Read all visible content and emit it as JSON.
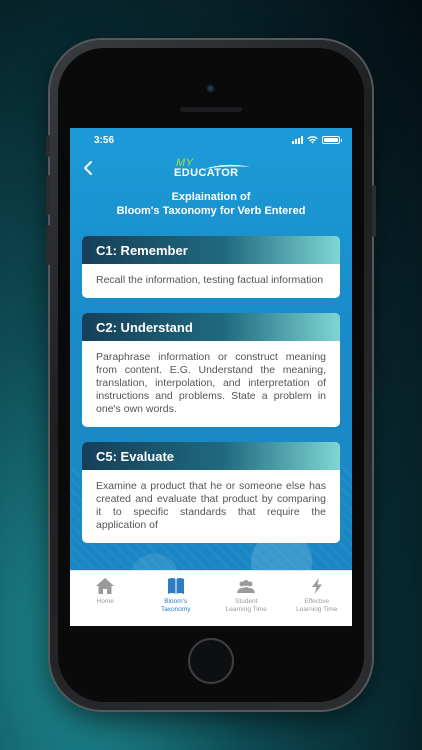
{
  "status_bar": {
    "time": "3:56"
  },
  "logo": {
    "my": "MY",
    "educator": "EDUCATOR"
  },
  "page": {
    "title_line1": "Explaination of",
    "title_line2": "Bloom's Taxonomy for Verb Entered"
  },
  "cards": [
    {
      "title": "C1: Remember",
      "body": "Recall the information, testing factual information"
    },
    {
      "title": "C2: Understand",
      "body": "Paraphrase information or construct meaning from content. E.G. Understand the meaning, translation, interpolation, and interpretation of instructions and problems. State a problem in one's own words."
    },
    {
      "title": "C5: Evaluate",
      "body": "Examine a product that he or someone else has created and evaluate that product by comparing it to specific standards that require the application of"
    }
  ],
  "tabs": [
    {
      "label_line1": "Home",
      "label_line2": "",
      "icon": "home-icon",
      "active": false
    },
    {
      "label_line1": "Bloom's",
      "label_line2": "Taxonomy",
      "icon": "book-icon",
      "active": true
    },
    {
      "label_line1": "Student",
      "label_line2": "Learning Time",
      "icon": "students-icon",
      "active": false
    },
    {
      "label_line1": "Effective",
      "label_line2": "Learning Time",
      "icon": "lightning-icon",
      "active": false
    }
  ],
  "colors": {
    "accent": "#2e7dc3",
    "screen_bg": "#1a8ac8",
    "card_header_start": "#163f58",
    "card_header_end": "#7ed6d3",
    "logo_green": "#9be24a"
  }
}
